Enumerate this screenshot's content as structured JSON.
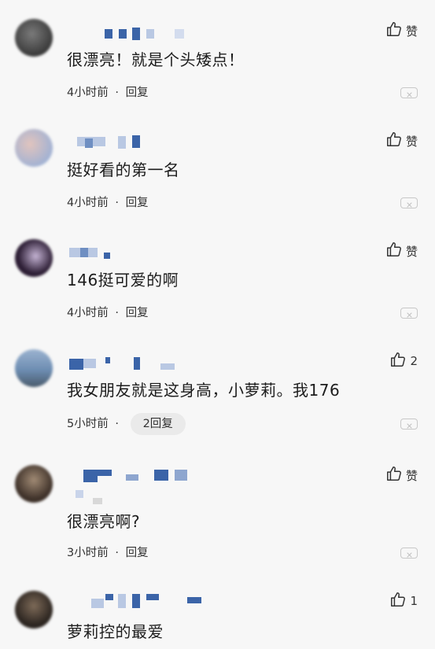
{
  "colors": {
    "background": "#f7f7f7",
    "mosaic_blue": "#3b64a8",
    "mosaic_light": "#b9c8e3"
  },
  "comments": [
    {
      "text": "很漂亮！就是个头矮点！",
      "time": "4小时前",
      "separator": "·",
      "reply_label": "回复",
      "like_label": "赞",
      "like_icon": "thumbs-up-icon",
      "avatar_colors": [
        "#6b6b6b",
        "#3a3a3a"
      ]
    },
    {
      "text": "挺好看的第一名",
      "time": "4小时前",
      "separator": "·",
      "reply_label": "回复",
      "like_label": "赞",
      "like_icon": "thumbs-up-icon",
      "avatar_colors": [
        "#d8b9b3",
        "#8fa6cf"
      ]
    },
    {
      "text": "146挺可爱的啊",
      "time": "4小时前",
      "separator": "·",
      "reply_label": "回复",
      "like_label": "赞",
      "like_icon": "thumbs-up-icon",
      "avatar_colors": [
        "#2c1d34",
        "#b7a5c4"
      ]
    },
    {
      "text": "我女朋友就是这身高，小萝莉。我176",
      "time": "5小时前",
      "separator": "·",
      "reply_label": "2回复",
      "like_label": "2",
      "like_icon": "thumbs-up-icon",
      "avatar_colors": [
        "#7d97b8",
        "#4c6e94"
      ]
    },
    {
      "text": "很漂亮啊?",
      "time": "3小时前",
      "separator": "·",
      "reply_label": "回复",
      "like_label": "赞",
      "like_icon": "thumbs-up-icon",
      "avatar_colors": [
        "#7a6a5c",
        "#3e3129"
      ]
    },
    {
      "text": "萝莉控的最爱",
      "time": "",
      "separator": "",
      "reply_label": "",
      "like_label": "1",
      "like_icon": "thumbs-up-icon",
      "avatar_colors": [
        "#5b4a3c",
        "#2c2520"
      ]
    }
  ]
}
